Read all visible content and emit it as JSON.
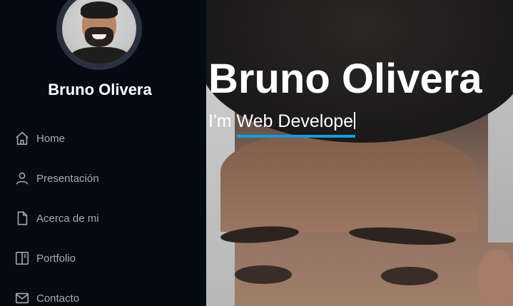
{
  "sidebar": {
    "profile_name": "Bruno Olivera",
    "nav": [
      {
        "label": "Home",
        "icon": "home-icon"
      },
      {
        "label": "Presentación",
        "icon": "person-icon"
      },
      {
        "label": "Acerca de mi",
        "icon": "file-icon"
      },
      {
        "label": "Portfolio",
        "icon": "book-half-icon"
      },
      {
        "label": "Contacto",
        "icon": "envelope-icon"
      }
    ]
  },
  "hero": {
    "title": "Bruno Olivera",
    "prefix": "I'm",
    "typed_text": "Web Develope"
  },
  "colors": {
    "sidebar_bg": "#040b14",
    "accent": "#149ddd",
    "nav_text": "#a8a9b4"
  }
}
